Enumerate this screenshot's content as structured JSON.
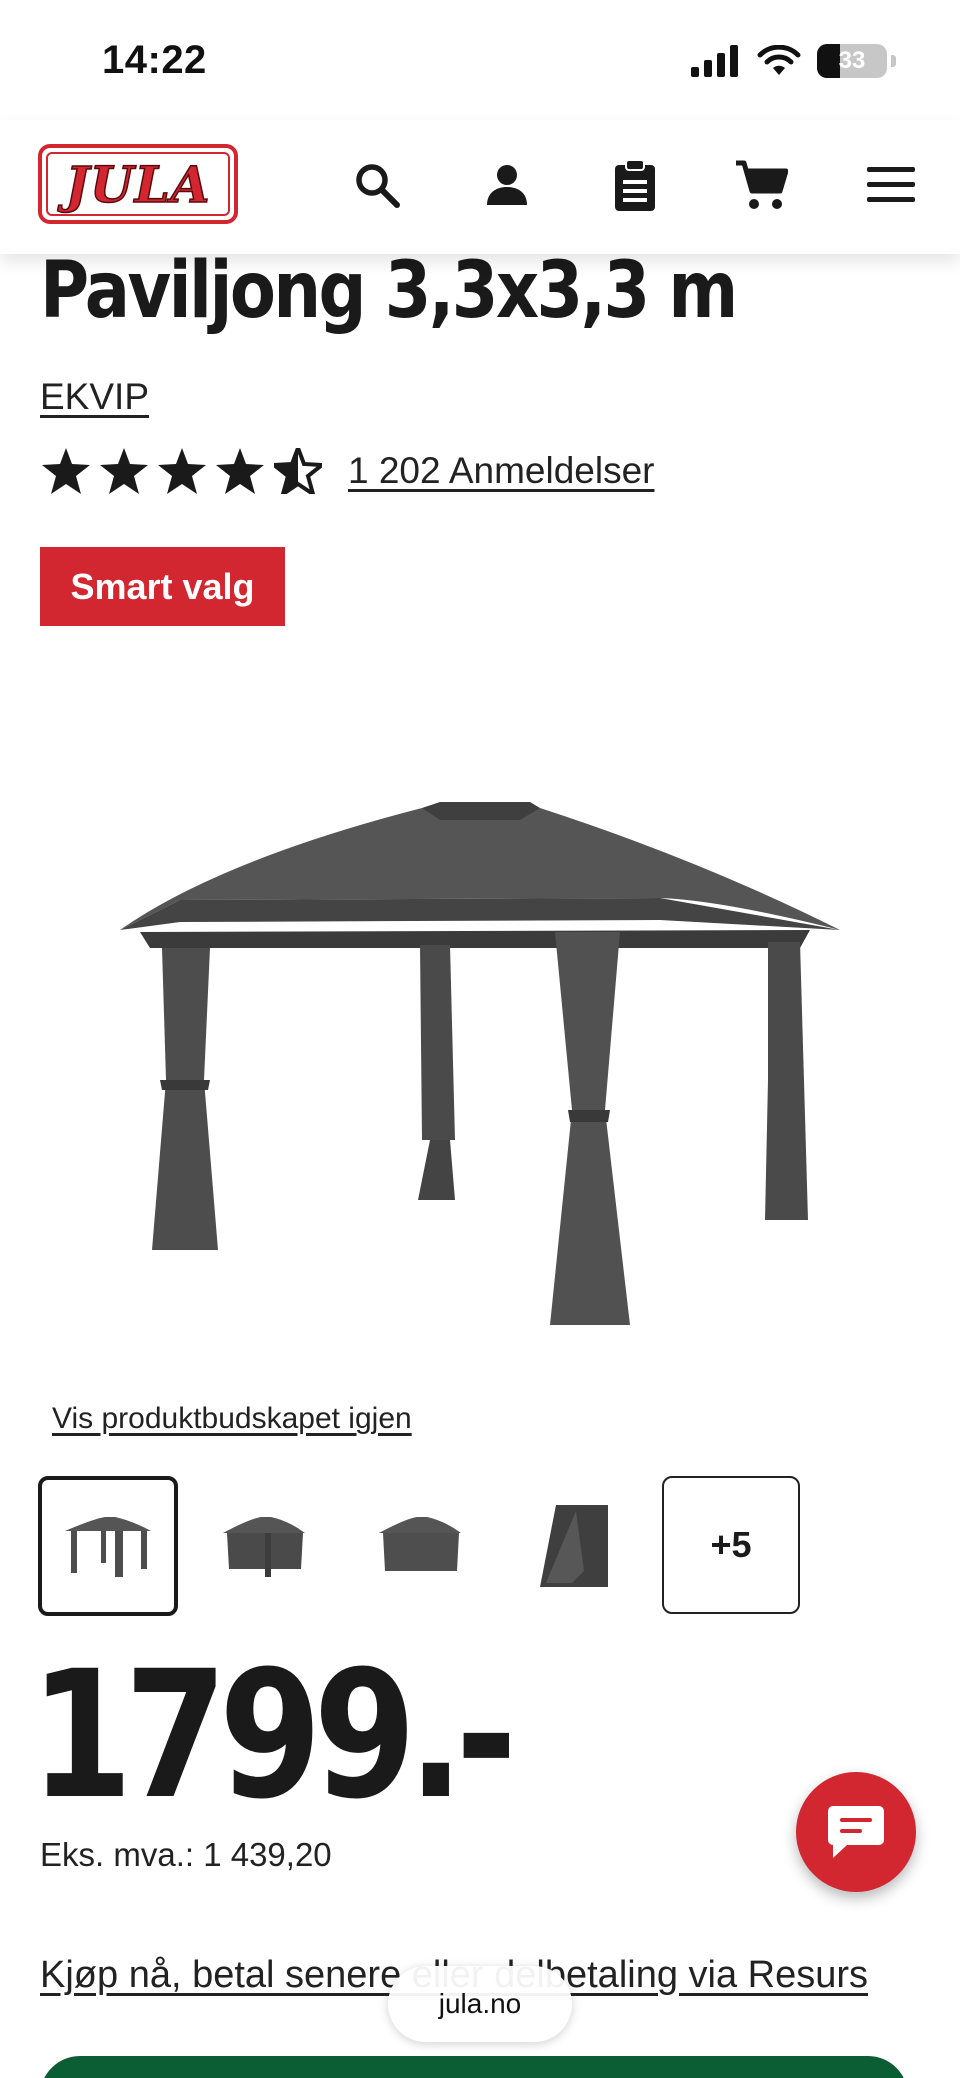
{
  "status_bar": {
    "time": "14:22",
    "battery": "33",
    "icons": [
      "cellular-signal-icon",
      "wifi-icon",
      "battery-icon"
    ]
  },
  "header": {
    "logo_text": "JULA",
    "icons": [
      "search-icon",
      "account-icon",
      "shopping-list-icon",
      "cart-icon",
      "menu-icon"
    ]
  },
  "product": {
    "title": "Paviljong 3,3x3,3 m",
    "brand": "EKVIP",
    "rating": 4.5,
    "reviews_label": "1 202 Anmeldelser",
    "badge": "Smart valg",
    "replay_link": "Vis produktbudskapet igjen",
    "more_images_label": "+5",
    "price": "1799.-",
    "vat_label": "Eks. mva.: 1 439,20",
    "financing_link": "Kjøp nå, betal senere eller delbetaling via Resurs"
  },
  "browser": {
    "url": "jula.no"
  },
  "colors": {
    "brand_red": "#d22630",
    "buy_green": "#0b5d33",
    "text": "#1a1a1a",
    "product_grey": "#4f4f4f"
  }
}
